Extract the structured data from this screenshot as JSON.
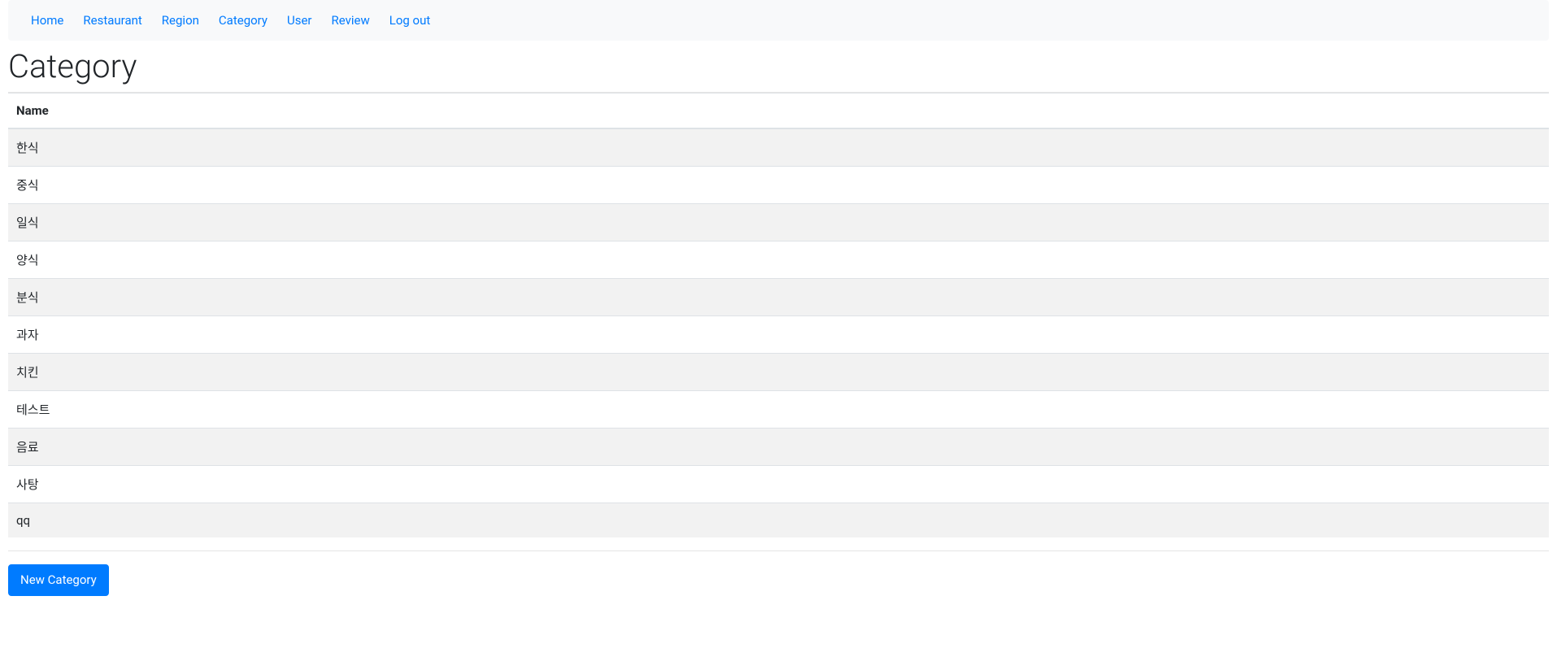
{
  "nav": {
    "items": [
      {
        "label": "Home"
      },
      {
        "label": "Restaurant"
      },
      {
        "label": "Region"
      },
      {
        "label": "Category"
      },
      {
        "label": "User"
      },
      {
        "label": "Review"
      },
      {
        "label": "Log out"
      }
    ]
  },
  "page": {
    "title": "Category"
  },
  "table": {
    "header": "Name",
    "rows": [
      "한식",
      "중식",
      "일식",
      "양식",
      "분식",
      "과자",
      "치킨",
      "테스트",
      "음료",
      "사탕",
      "qq"
    ]
  },
  "actions": {
    "new_label": "New Category"
  }
}
